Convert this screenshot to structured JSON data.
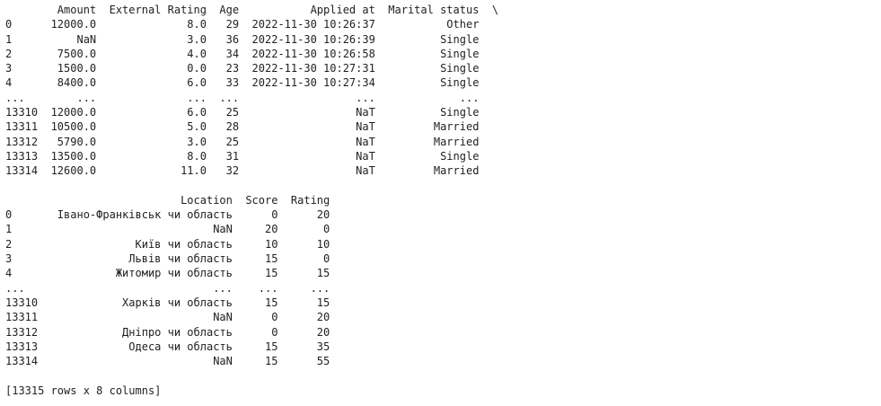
{
  "table1": {
    "header": [
      "",
      "Amount",
      "External Rating",
      "Age",
      "Applied at",
      "Marital status",
      "\\"
    ],
    "rows": [
      [
        "0",
        "12000.0",
        "8.0",
        "29",
        "2022-11-30 10:26:37",
        "Other"
      ],
      [
        "1",
        "NaN",
        "3.0",
        "36",
        "2022-11-30 10:26:39",
        "Single"
      ],
      [
        "2",
        "7500.0",
        "4.0",
        "34",
        "2022-11-30 10:26:58",
        "Single"
      ],
      [
        "3",
        "1500.0",
        "0.0",
        "23",
        "2022-11-30 10:27:31",
        "Single"
      ],
      [
        "4",
        "8400.0",
        "6.0",
        "33",
        "2022-11-30 10:27:34",
        "Single"
      ],
      [
        "...",
        "...",
        "...",
        "...",
        "...",
        "..."
      ],
      [
        "13310",
        "12000.0",
        "6.0",
        "25",
        "NaT",
        "Single"
      ],
      [
        "13311",
        "10500.0",
        "5.0",
        "28",
        "NaT",
        "Married"
      ],
      [
        "13312",
        "5790.0",
        "3.0",
        "25",
        "NaT",
        "Married"
      ],
      [
        "13313",
        "13500.0",
        "8.0",
        "31",
        "NaT",
        "Single"
      ],
      [
        "13314",
        "12600.0",
        "11.0",
        "32",
        "NaT",
        "Married"
      ]
    ]
  },
  "table2": {
    "header": [
      "",
      "Location",
      "Score",
      "Rating"
    ],
    "rows": [
      [
        "0",
        "Івано-Франківськ чи область",
        "0",
        "20"
      ],
      [
        "1",
        "NaN",
        "20",
        "0"
      ],
      [
        "2",
        "Київ чи область",
        "10",
        "10"
      ],
      [
        "3",
        "Львів чи область",
        "15",
        "0"
      ],
      [
        "4",
        "Житомир чи область",
        "15",
        "15"
      ],
      [
        "...",
        "...",
        "...",
        "..."
      ],
      [
        "13310",
        "Харків чи область",
        "15",
        "15"
      ],
      [
        "13311",
        "NaN",
        "0",
        "20"
      ],
      [
        "13312",
        "Дніпро чи область",
        "0",
        "20"
      ],
      [
        "13313",
        "Одеса чи область",
        "15",
        "35"
      ],
      [
        "13314",
        "NaN",
        "15",
        "55"
      ]
    ]
  },
  "summary": "[13315 rows x 8 columns]"
}
